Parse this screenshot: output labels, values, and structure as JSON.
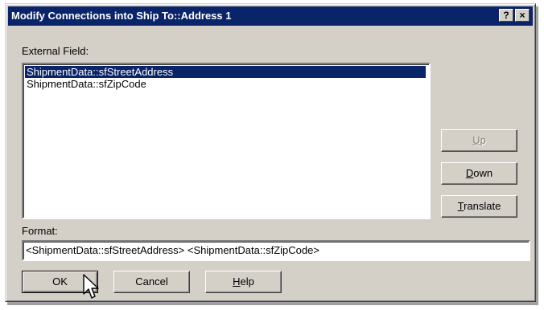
{
  "window": {
    "title": "Modify Connections into Ship To::Address 1",
    "help_button": "?",
    "close_button": "×"
  },
  "external_field": {
    "label": "External Field:",
    "items": [
      {
        "text": "ShipmentData::sfStreetAddress",
        "selected": true
      },
      {
        "text": "ShipmentData::sfZipCode",
        "selected": false
      }
    ]
  },
  "side_buttons": {
    "up": {
      "mnemonic": "U",
      "rest": "p",
      "enabled": false
    },
    "down": {
      "mnemonic": "D",
      "rest": "own",
      "enabled": true
    },
    "translate": {
      "mnemonic": "T",
      "rest": "ranslate",
      "enabled": true
    }
  },
  "format": {
    "label": "Format:",
    "value": "<ShipmentData::sfStreetAddress> <ShipmentData::sfZipCode>"
  },
  "bottom_buttons": {
    "ok": "OK",
    "cancel": "Cancel",
    "help_mnemonic": "H",
    "help_rest": "elp"
  },
  "colors": {
    "dialog_face": "#d4d0c8",
    "titlebar": "#0a246a",
    "selection": "#0a246a"
  },
  "icons": {
    "cursor": "arrow-cursor-icon"
  }
}
